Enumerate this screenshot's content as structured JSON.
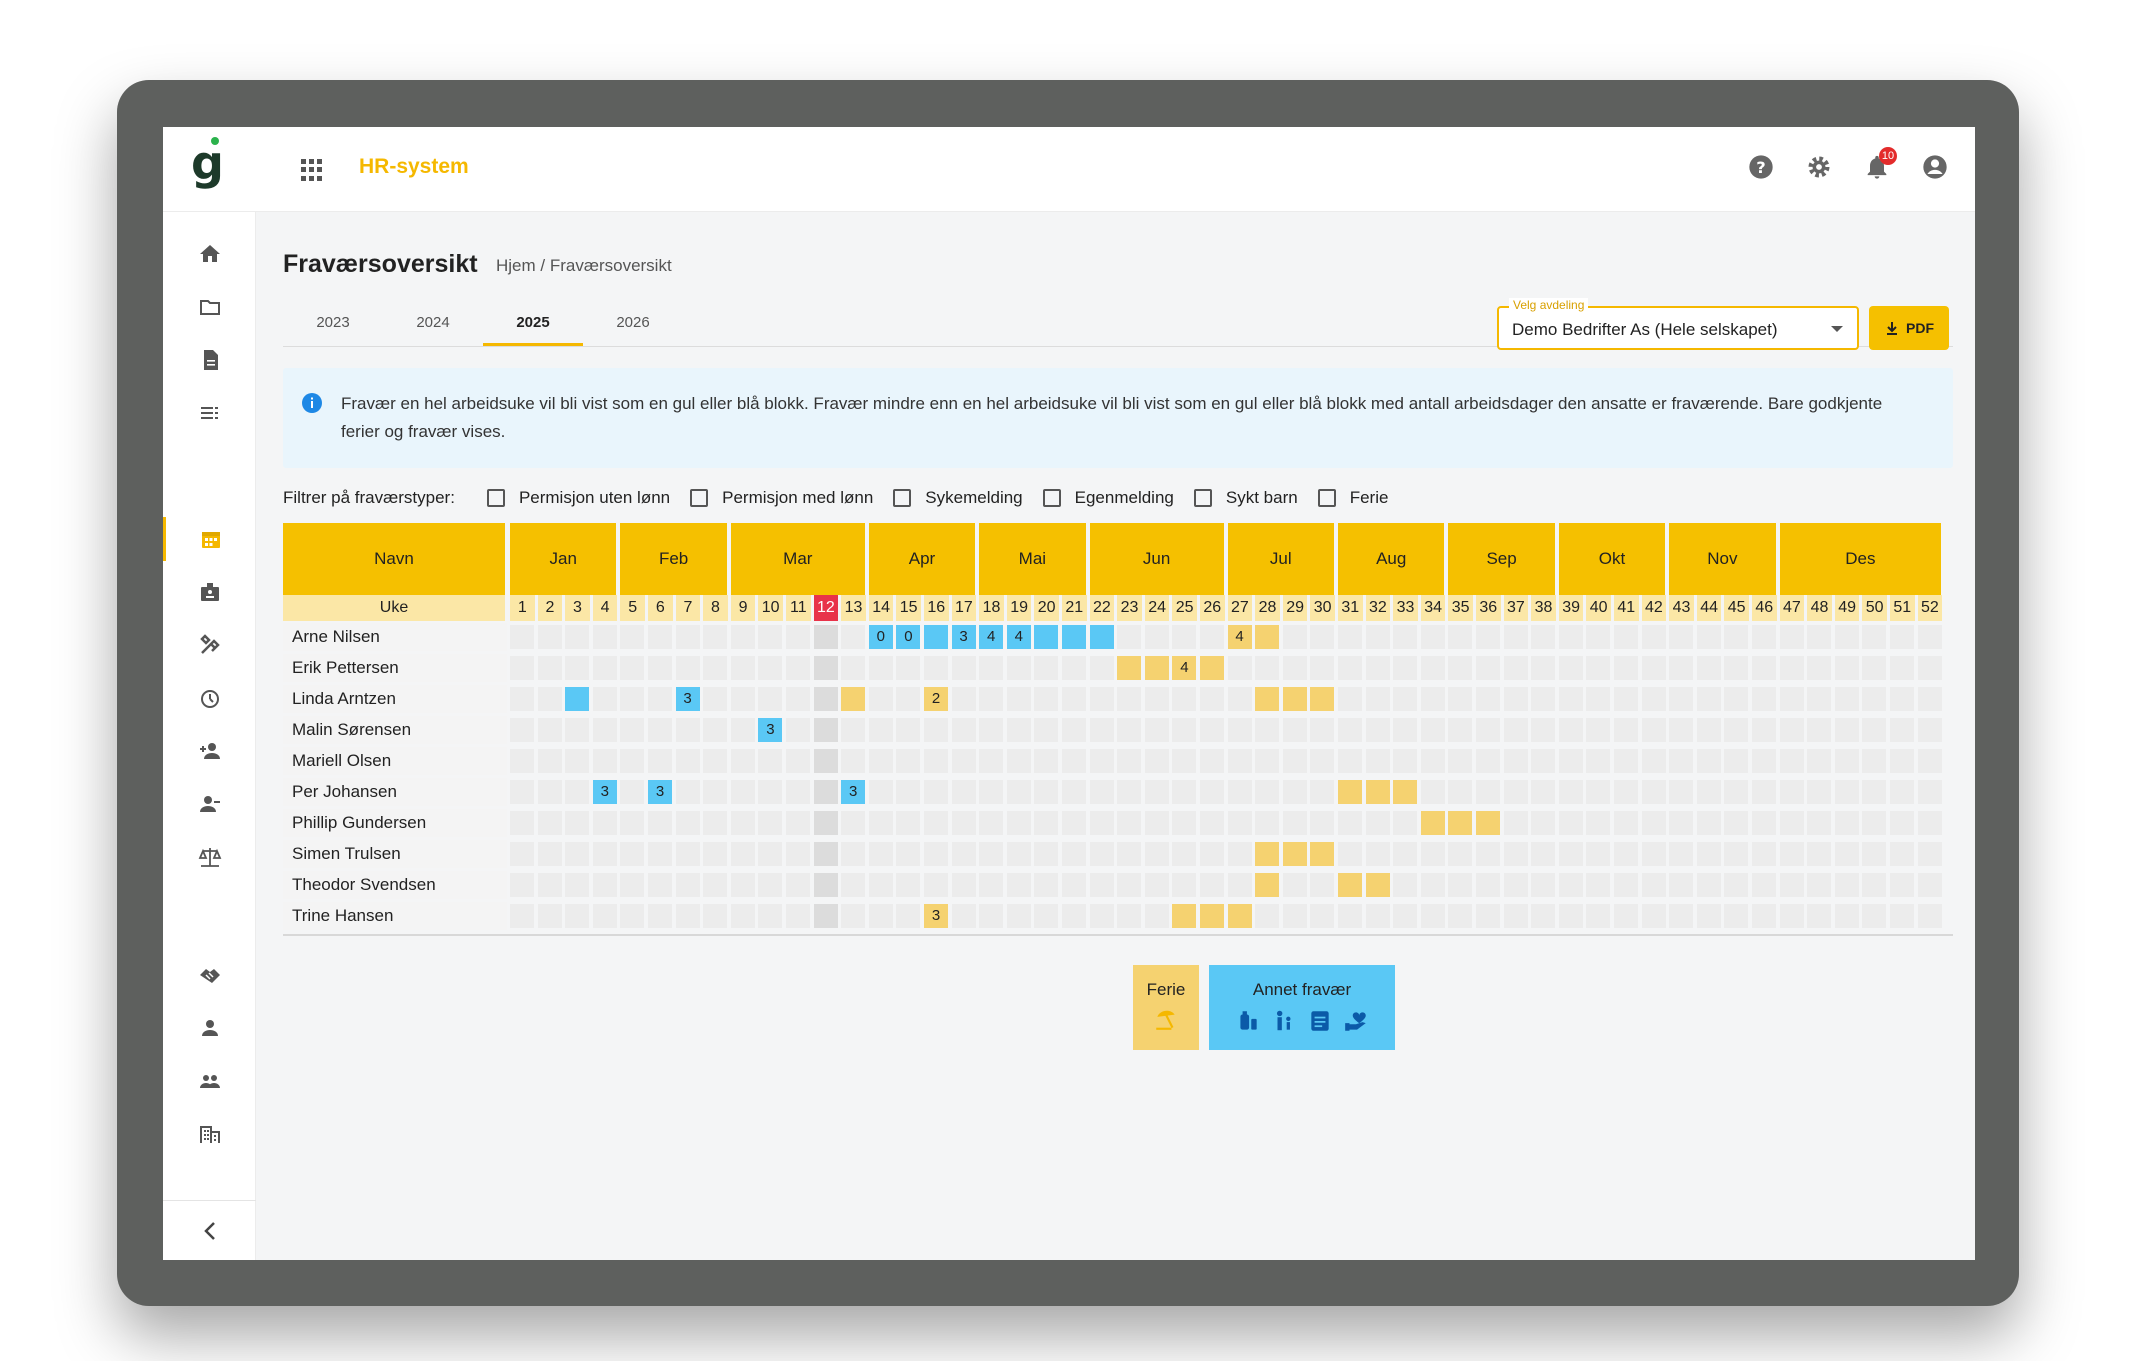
{
  "app": {
    "title": "HR-system",
    "notification_count": "10"
  },
  "page": {
    "title": "Fraværsoversikt",
    "breadcrumb": "Hjem  /  Fraværsoversikt"
  },
  "tabs": [
    {
      "label": "2023"
    },
    {
      "label": "2024"
    },
    {
      "label": "2025",
      "active": true
    },
    {
      "label": "2026"
    }
  ],
  "department": {
    "label": "Velg avdeling",
    "value": "Demo Bedrifter As (Hele selskapet)"
  },
  "pdf_button": "PDF",
  "info_text": "Fravær en hel arbeidsuke vil bli vist som en gul eller blå blokk. Fravær mindre enn en hel arbeidsuke vil bli vist som en gul eller blå blokk med antall arbeidsdager den ansatte er fraværende. Bare godkjente ferier og fravær vises.",
  "filters": {
    "label": "Filtrer på fraværstyper:",
    "options": [
      "Permisjon uten lønn",
      "Permisjon med lønn",
      "Sykemelding",
      "Egenmelding",
      "Sykt barn",
      "Ferie"
    ]
  },
  "table": {
    "name_header": "Navn",
    "week_header": "Uke",
    "months": [
      "Jan",
      "Feb",
      "Mar",
      "Apr",
      "Mai",
      "Jun",
      "Jul",
      "Aug",
      "Sep",
      "Okt",
      "Nov",
      "Des"
    ],
    "current_week": 12,
    "colors": {
      "ferie": "#f5d270",
      "annet": "#5ac8f5",
      "current": "#e8334a",
      "header": "#f5c000"
    },
    "employees": [
      {
        "name": "Arne Nilsen",
        "absences": [
          {
            "week": 14,
            "type": "annet",
            "days": "0"
          },
          {
            "week": 15,
            "type": "annet",
            "days": "0"
          },
          {
            "week": 16,
            "type": "annet",
            "days": ""
          },
          {
            "week": 17,
            "type": "annet",
            "days": "3"
          },
          {
            "week": 18,
            "type": "annet",
            "days": "4"
          },
          {
            "week": 19,
            "type": "annet",
            "days": "4"
          },
          {
            "week": 20,
            "type": "annet",
            "days": ""
          },
          {
            "week": 21,
            "type": "annet",
            "days": ""
          },
          {
            "week": 22,
            "type": "annet",
            "days": ""
          },
          {
            "week": 27,
            "type": "ferie",
            "days": "4"
          },
          {
            "week": 28,
            "type": "ferie",
            "days": ""
          }
        ]
      },
      {
        "name": "Erik Pettersen",
        "absences": [
          {
            "week": 23,
            "type": "ferie",
            "days": ""
          },
          {
            "week": 24,
            "type": "ferie",
            "days": ""
          },
          {
            "week": 25,
            "type": "ferie",
            "days": "4"
          },
          {
            "week": 26,
            "type": "ferie",
            "days": ""
          }
        ]
      },
      {
        "name": "Linda Arntzen",
        "absences": [
          {
            "week": 3,
            "type": "annet",
            "days": ""
          },
          {
            "week": 7,
            "type": "annet",
            "days": "3"
          },
          {
            "week": 13,
            "type": "ferie",
            "days": ""
          },
          {
            "week": 16,
            "type": "ferie",
            "days": "2"
          },
          {
            "week": 28,
            "type": "ferie",
            "days": ""
          },
          {
            "week": 29,
            "type": "ferie",
            "days": ""
          },
          {
            "week": 30,
            "type": "ferie",
            "days": ""
          }
        ]
      },
      {
        "name": "Malin Sørensen",
        "absences": [
          {
            "week": 10,
            "type": "annet",
            "days": "3"
          }
        ]
      },
      {
        "name": "Mariell Olsen",
        "absences": []
      },
      {
        "name": "Per Johansen",
        "absences": [
          {
            "week": 4,
            "type": "annet",
            "days": "3"
          },
          {
            "week": 6,
            "type": "annet",
            "days": "3"
          },
          {
            "week": 13,
            "type": "annet",
            "days": "3"
          },
          {
            "week": 31,
            "type": "ferie",
            "days": ""
          },
          {
            "week": 32,
            "type": "ferie",
            "days": ""
          },
          {
            "week": 33,
            "type": "ferie",
            "days": ""
          }
        ]
      },
      {
        "name": "Phillip Gundersen",
        "absences": [
          {
            "week": 34,
            "type": "ferie",
            "days": ""
          },
          {
            "week": 35,
            "type": "ferie",
            "days": ""
          },
          {
            "week": 36,
            "type": "ferie",
            "days": ""
          }
        ]
      },
      {
        "name": "Simen Trulsen",
        "absences": [
          {
            "week": 28,
            "type": "ferie",
            "days": ""
          },
          {
            "week": 29,
            "type": "ferie",
            "days": ""
          },
          {
            "week": 30,
            "type": "ferie",
            "days": ""
          }
        ]
      },
      {
        "name": "Theodor Svendsen",
        "absences": [
          {
            "week": 28,
            "type": "ferie",
            "days": ""
          },
          {
            "week": 31,
            "type": "ferie",
            "days": ""
          },
          {
            "week": 32,
            "type": "ferie",
            "days": ""
          }
        ]
      },
      {
        "name": "Trine Hansen",
        "absences": [
          {
            "week": 16,
            "type": "ferie",
            "days": "3"
          },
          {
            "week": 25,
            "type": "ferie",
            "days": ""
          },
          {
            "week": 26,
            "type": "ferie",
            "days": ""
          },
          {
            "week": 27,
            "type": "ferie",
            "days": ""
          }
        ]
      }
    ]
  },
  "legend": {
    "ferie": "Ferie",
    "annet": "Annet fravær"
  },
  "sidebar_icons": [
    "home-icon",
    "folder-icon",
    "document-icon",
    "list-icon",
    "calendar-icon",
    "badge-icon",
    "tools-icon",
    "timer-icon",
    "add-person-icon",
    "remove-person-icon",
    "scale-icon",
    "handshake-icon",
    "person-icon",
    "group-icon",
    "building-icon"
  ]
}
